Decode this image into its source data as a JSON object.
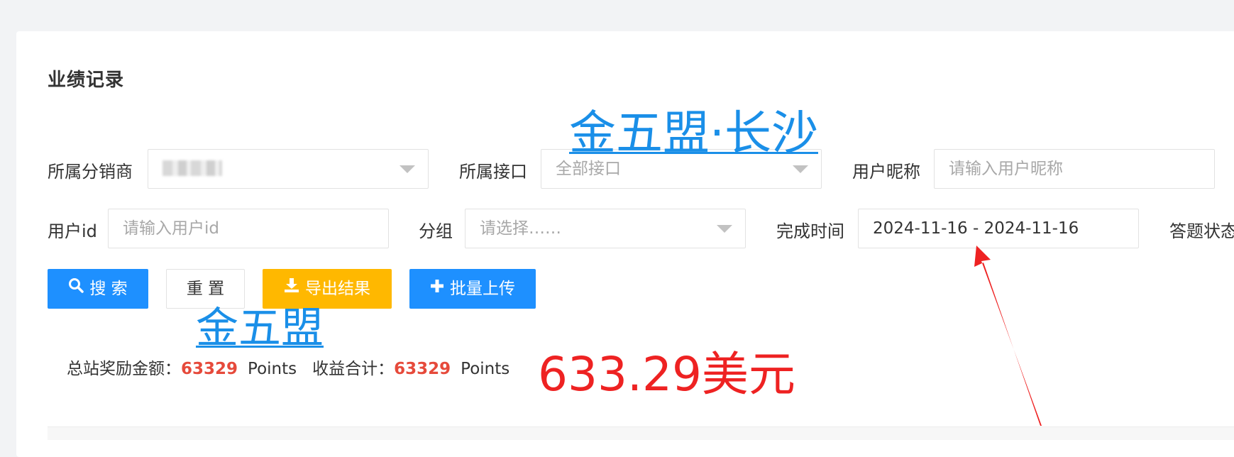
{
  "page": {
    "title": "业绩记录"
  },
  "filters": {
    "distributor": {
      "label": "所属分销商",
      "value": ""
    },
    "interface": {
      "label": "所属接口",
      "placeholder": "全部接口"
    },
    "nickname": {
      "label": "用户昵称",
      "placeholder": "请输入用户昵称"
    },
    "user_id": {
      "label": "用户id",
      "placeholder": "请输入用户id"
    },
    "group": {
      "label": "分组",
      "placeholder": "请选择……"
    },
    "finish_time": {
      "label": "完成时间",
      "value": "2024-11-16 - 2024-11-16"
    },
    "answer_status": {
      "label": "答题状态"
    }
  },
  "buttons": {
    "search": "搜 索",
    "reset": "重 置",
    "export": "导出结果",
    "batch_upload": "批量上传"
  },
  "summary": {
    "reward_label": "总站奖励金额：",
    "reward_value": "63329",
    "reward_unit": "Points",
    "income_label": "收益合计：",
    "income_value": "63329",
    "income_unit": "Points"
  },
  "overlay": {
    "watermark_top": "金五盟·长沙",
    "watermark_bottom": "金五盟",
    "amount": "633.29美元"
  },
  "colors": {
    "primary": "#1e90ff",
    "warning": "#ffb800",
    "highlight_number": "#e64a3b",
    "annotation_red": "#ee2222",
    "watermark_blue": "#1a8fe8"
  }
}
